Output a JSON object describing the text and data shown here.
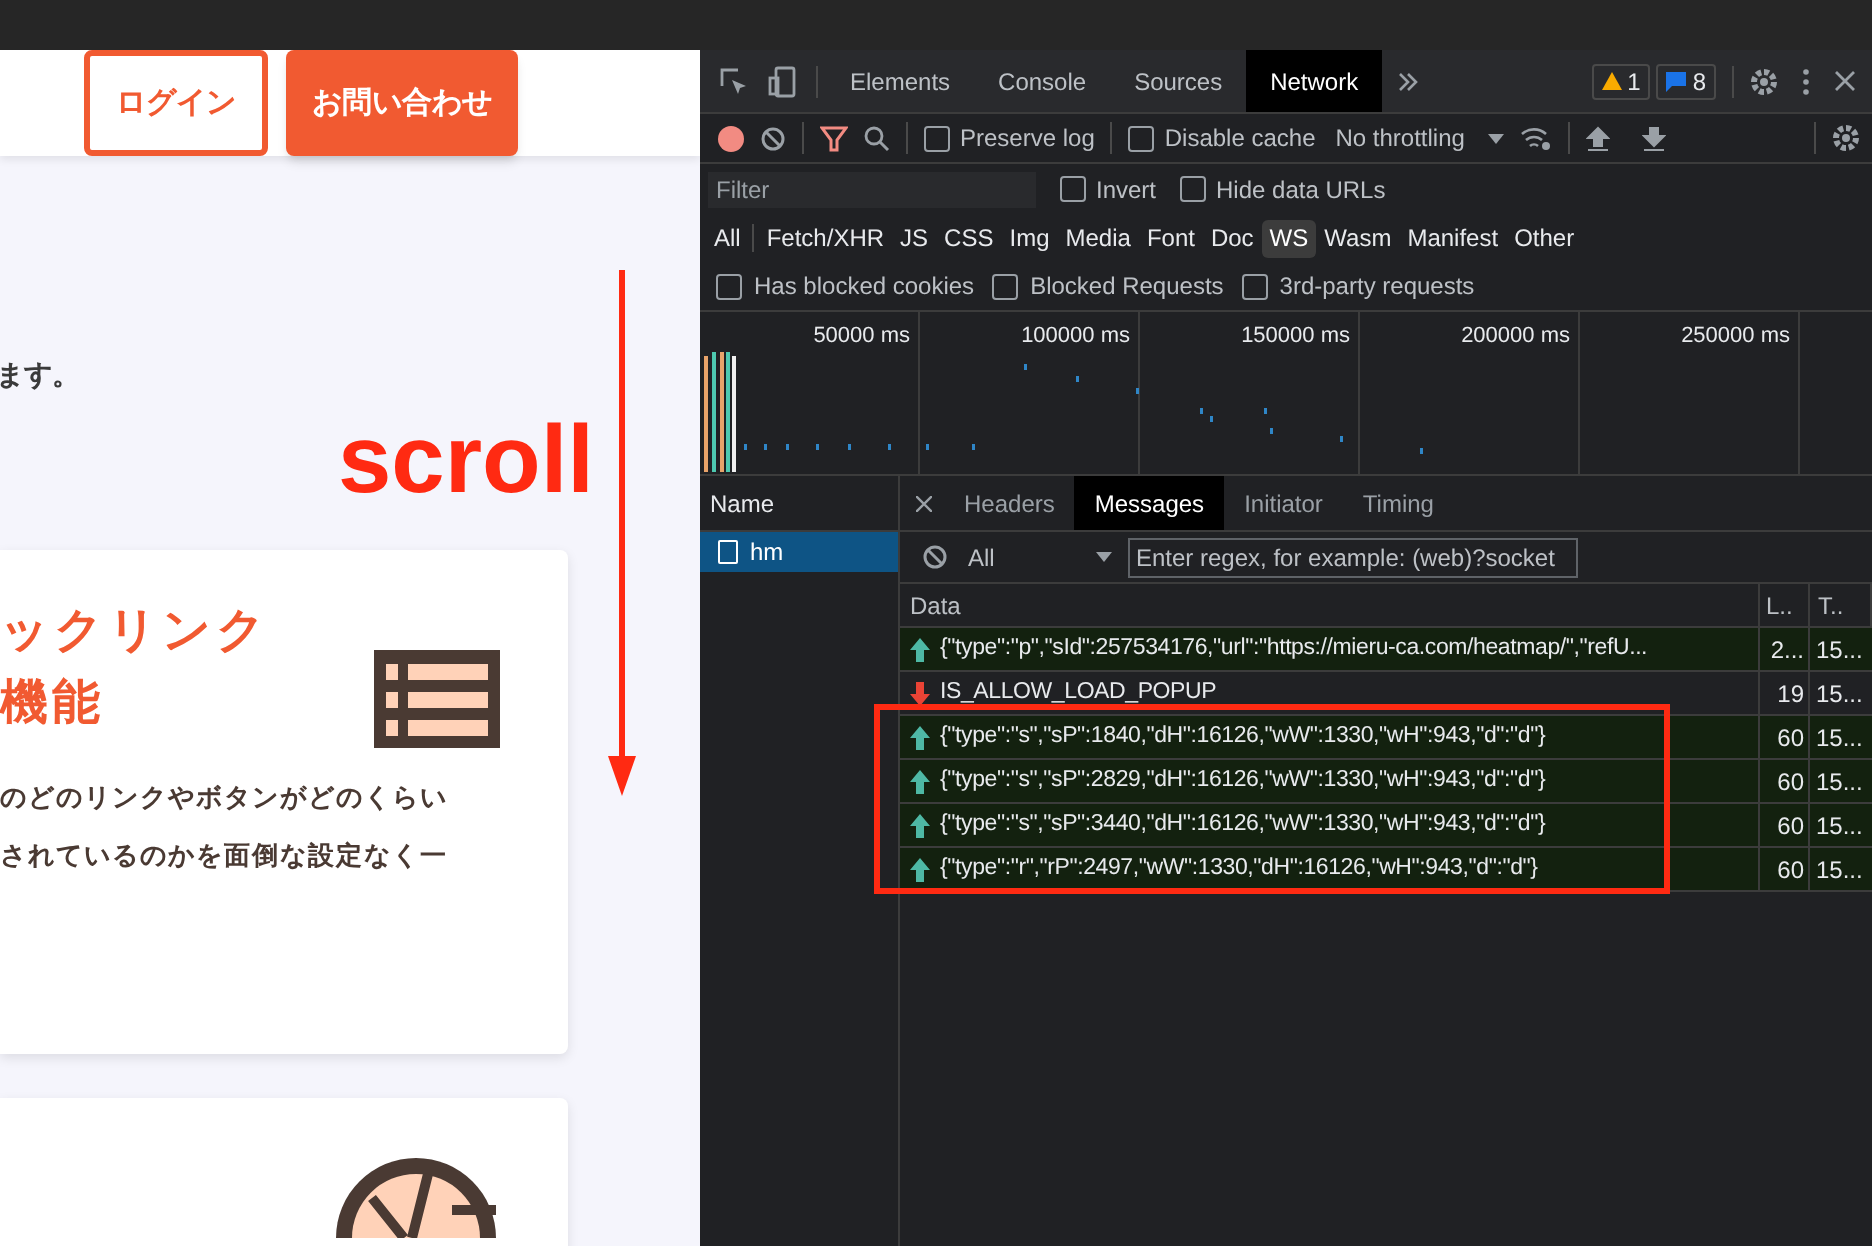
{
  "page": {
    "header_buttons": [
      {
        "label": "ログイン",
        "kind": "outline"
      },
      {
        "label": "お問い合わせ",
        "kind": "filled"
      }
    ],
    "intro_text": "ます。",
    "annotation": {
      "label": "scroll"
    },
    "cards": [
      {
        "kind": "list",
        "title_lines": [
          "ックリンク",
          "機能"
        ],
        "body_lines": [
          "のどのリンクやボタンがどのくらい",
          "されているのかを面倒な設定なく一"
        ]
      },
      {
        "kind": "aperture"
      }
    ]
  },
  "devtools": {
    "tabs": [
      {
        "label": "Elements",
        "selected": false
      },
      {
        "label": "Console",
        "selected": false
      },
      {
        "label": "Sources",
        "selected": false
      },
      {
        "label": "Network",
        "selected": true
      }
    ],
    "warnings": "1",
    "messages_count": "8",
    "toolbar": {
      "recording": true,
      "preserve_log": {
        "label": "Preserve log",
        "checked": false
      },
      "disable_cache": {
        "label": "Disable cache",
        "checked": false
      },
      "throttling": "No throttling"
    },
    "filter": {
      "placeholder": "Filter",
      "invert": {
        "label": "Invert",
        "checked": false
      },
      "hide_data_urls": {
        "label": "Hide data URLs",
        "checked": false
      }
    },
    "types": [
      {
        "label": "All",
        "selected": false
      },
      {
        "label": "Fetch/XHR",
        "selected": false
      },
      {
        "label": "JS",
        "selected": false
      },
      {
        "label": "CSS",
        "selected": false
      },
      {
        "label": "Img",
        "selected": false
      },
      {
        "label": "Media",
        "selected": false
      },
      {
        "label": "Font",
        "selected": false
      },
      {
        "label": "Doc",
        "selected": false
      },
      {
        "label": "WS",
        "selected": true
      },
      {
        "label": "Wasm",
        "selected": false
      },
      {
        "label": "Manifest",
        "selected": false
      },
      {
        "label": "Other",
        "selected": false
      }
    ],
    "blocked_filters": [
      {
        "label": "Has blocked cookies",
        "checked": false
      },
      {
        "label": "Blocked Requests",
        "checked": false
      },
      {
        "label": "3rd-party requests",
        "checked": false
      }
    ],
    "timeline_ticks": [
      "50000 ms",
      "100000 ms",
      "150000 ms",
      "200000 ms",
      "250000 ms"
    ],
    "name_column": {
      "heading": "Name",
      "requests": [
        {
          "name": "hm",
          "selected": true
        }
      ]
    },
    "detail_tabs": [
      {
        "label": "Headers",
        "selected": false
      },
      {
        "label": "Messages",
        "selected": true
      },
      {
        "label": "Initiator",
        "selected": false
      },
      {
        "label": "Timing",
        "selected": false
      }
    ],
    "message_filter": {
      "type": "All",
      "placeholder": "Enter regex, for example: (web)?socket"
    },
    "messages": {
      "columns": [
        "Data",
        "L..",
        "T.."
      ],
      "rows": [
        {
          "kind": "sent",
          "data": "{\"type\":\"p\",\"sId\":257534176,\"url\":\"https://mieru-ca.com/heatmap/\",\"refU...",
          "length": "2...",
          "time": "15..."
        },
        {
          "kind": "received",
          "data": "IS_ALLOW_LOAD_POPUP",
          "length": "19",
          "time": "15..."
        },
        {
          "kind": "sent",
          "data": "{\"type\":\"s\",\"sP\":1840,\"dH\":16126,\"wW\":1330,\"wH\":943,\"d\":\"d\"}",
          "length": "60",
          "time": "15..."
        },
        {
          "kind": "sent",
          "data": "{\"type\":\"s\",\"sP\":2829,\"dH\":16126,\"wW\":1330,\"wH\":943,\"d\":\"d\"}",
          "length": "60",
          "time": "15..."
        },
        {
          "kind": "sent",
          "data": "{\"type\":\"s\",\"sP\":3440,\"dH\":16126,\"wW\":1330,\"wH\":943,\"d\":\"d\"}",
          "length": "60",
          "time": "15..."
        },
        {
          "kind": "sent",
          "data": "{\"type\":\"r\",\"rP\":2497,\"wW\":1330,\"dH\":16126,\"wH\":943,\"d\":\"d\"}",
          "length": "60",
          "time": "15..."
        }
      ]
    }
  }
}
